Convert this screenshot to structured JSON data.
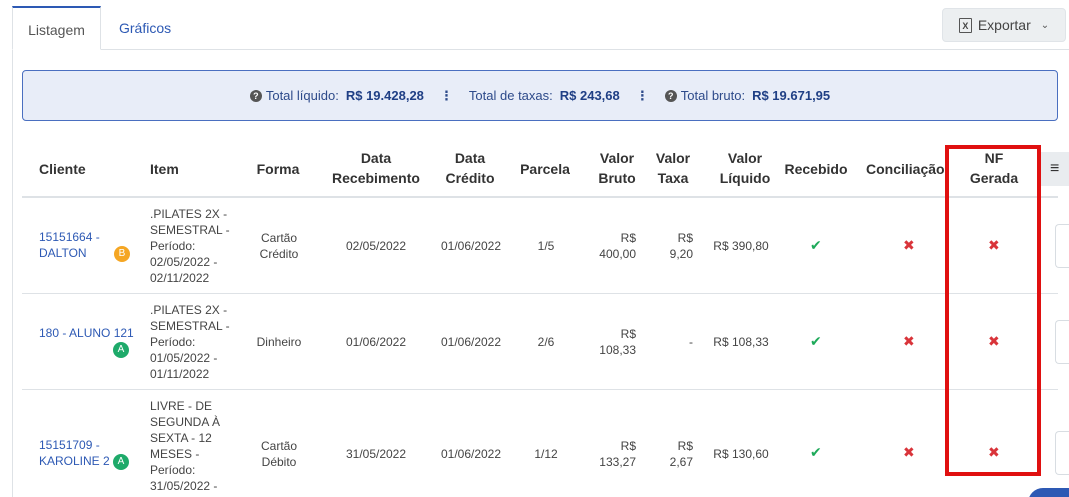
{
  "tabs": [
    {
      "label": "Listagem",
      "active": true
    },
    {
      "label": "Gráficos",
      "active": false
    }
  ],
  "export": {
    "label": "Exportar",
    "icon": "excel-icon"
  },
  "summary": {
    "net_label": "Total líquido:",
    "net_value": "R$ 19.428,28",
    "fees_label": "Total de taxas:",
    "fees_value": "R$ 243,68",
    "gross_label": "Total bruto:",
    "gross_value": "R$ 19.671,95"
  },
  "columns": {
    "cliente": "Cliente",
    "item": "Item",
    "forma": "Forma",
    "data_receb_1": "Data",
    "data_receb_2": "Recebimento",
    "data_cred_1": "Data",
    "data_cred_2": "Crédito",
    "parcela": "Parcela",
    "vbruto_1": "Valor",
    "vbruto_2": "Bruto",
    "vtaxa_1": "Valor",
    "vtaxa_2": "Taxa",
    "vliq_1": "Valor",
    "vliq_2": "Líquido",
    "recebido": "Recebido",
    "conciliacao": "Conciliação",
    "nf_1": "NF",
    "nf_2": "Gerada"
  },
  "rows": [
    {
      "client_1": "15151664 -",
      "client_2": "DALTON",
      "badge": "B",
      "badge_color": "#f5a623",
      "item": [
        ".PILATES 2X -",
        "SEMESTRAL -",
        "Período:",
        "02/05/2022 -",
        "02/11/2022"
      ],
      "forma_1": "Cartão",
      "forma_2": "Crédito",
      "data_receb": "02/05/2022",
      "data_cred": "01/06/2022",
      "parcela": "1/5",
      "bruto_1": "R$",
      "bruto_2": "400,00",
      "taxa_1": "R$",
      "taxa_2": "9,20",
      "liquido": "R$ 390,80",
      "recebido": true,
      "conciliacao": false,
      "nf": false
    },
    {
      "client_1": "180 - ALUNO 121",
      "client_2": "",
      "badge": "A",
      "badge_color": "#1eaa6a",
      "item": [
        ".PILATES 2X -",
        "SEMESTRAL -",
        "Período:",
        "01/05/2022 -",
        "01/11/2022"
      ],
      "forma_1": "Dinheiro",
      "forma_2": "",
      "data_receb": "01/06/2022",
      "data_cred": "01/06/2022",
      "parcela": "2/6",
      "bruto_1": "R$",
      "bruto_2": "108,33",
      "taxa_1": "-",
      "taxa_2": "",
      "liquido": "R$ 108,33",
      "recebido": true,
      "conciliacao": false,
      "nf": false
    },
    {
      "client_1": "15151709 -",
      "client_2": "KAROLINE 2",
      "badge": "A",
      "badge_color": "#1eaa6a",
      "item": [
        "LIVRE - DE",
        "SEGUNDA À",
        "SEXTA - 12",
        "MESES -",
        "Período:",
        "31/05/2022 -"
      ],
      "forma_1": "Cartão",
      "forma_2": "Débito",
      "data_receb": "31/05/2022",
      "data_cred": "01/06/2022",
      "parcela": "1/12",
      "bruto_1": "R$",
      "bruto_2": "133,27",
      "taxa_1": "R$",
      "taxa_2": "2,67",
      "liquido": "R$ 130,60",
      "recebido": true,
      "conciliacao": false,
      "nf": false
    }
  ],
  "icons": {
    "check": "✔",
    "cross": "✖",
    "menu": "≡"
  },
  "colors": {
    "accent": "#2d59b4",
    "success": "#1eaa5a",
    "danger": "#d9343a",
    "highlight": "#e01010"
  }
}
